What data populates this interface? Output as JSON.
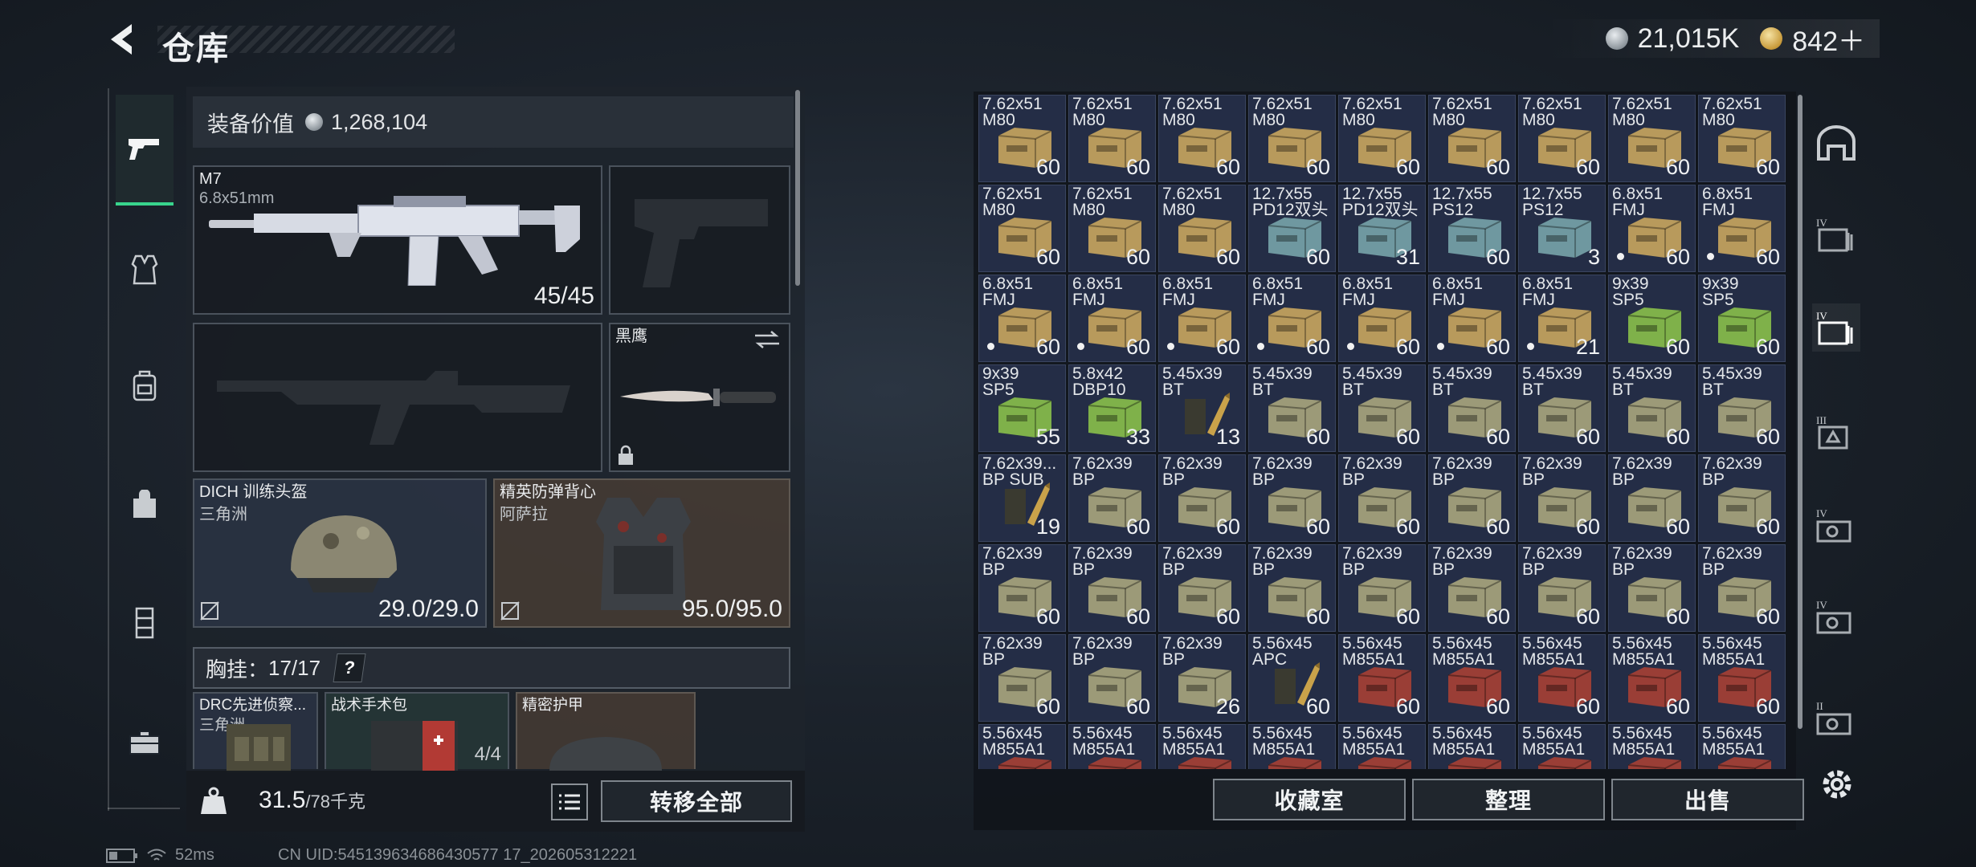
{
  "header": {
    "title": "仓库",
    "currencies": [
      {
        "icon": "silver-coin-icon",
        "value": "21,015K"
      },
      {
        "icon": "gold-coin-icon",
        "value": "842＋"
      }
    ]
  },
  "side_tabs": [
    {
      "name": "weapons-tab",
      "icon": "pistol-icon",
      "active": true
    },
    {
      "name": "armor-vest-tab",
      "icon": "vest-icon"
    },
    {
      "name": "backpack-tab",
      "icon": "backpack-icon"
    },
    {
      "name": "bag-tab",
      "icon": "bag-icon"
    },
    {
      "name": "rig-tab",
      "icon": "rig-icon"
    },
    {
      "name": "case-tab",
      "icon": "toolbox-icon"
    }
  ],
  "loadout": {
    "value_label": "装备价值",
    "value": "1,268,104",
    "primary": {
      "name": "M7",
      "caliber": "6.8x51mm",
      "ammo": "45/45"
    },
    "melee": {
      "name": "黑鹰"
    },
    "helmet": {
      "name": "DICH 训练头盔",
      "faction": "三角洲",
      "durability": "29.0/29.0"
    },
    "armor": {
      "name": "精英防弹背心",
      "faction": "阿萨拉",
      "durability": "95.0/95.0"
    },
    "chest_rig": {
      "label": "胸挂：",
      "value": "17/17",
      "help": "?"
    },
    "sub_slots": [
      {
        "name": "DRC先进侦察...",
        "faction": "三角洲"
      },
      {
        "name": "战术手术包",
        "count": "4/4"
      },
      {
        "name": "精密护甲"
      }
    ],
    "weight": {
      "value": "31.5",
      "max": "/78千克"
    },
    "transfer_all": "转移全部"
  },
  "inventory": {
    "colors": {
      "tan": "#b89a5c",
      "teal": "#6f98a0",
      "green": "#7fb14a",
      "olive": "#9c9a78",
      "red": "#9a3e36",
      "brass": "#c9a24a"
    },
    "items": [
      {
        "cal": "7.62x51\nM80",
        "qty": "60",
        "color": "tan"
      },
      {
        "cal": "7.62x51\nM80",
        "qty": "60",
        "color": "tan"
      },
      {
        "cal": "7.62x51\nM80",
        "qty": "60",
        "color": "tan"
      },
      {
        "cal": "7.62x51\nM80",
        "qty": "60",
        "color": "tan"
      },
      {
        "cal": "7.62x51\nM80",
        "qty": "60",
        "color": "tan"
      },
      {
        "cal": "7.62x51\nM80",
        "qty": "60",
        "color": "tan"
      },
      {
        "cal": "7.62x51\nM80",
        "qty": "60",
        "color": "tan"
      },
      {
        "cal": "7.62x51\nM80",
        "qty": "60",
        "color": "tan"
      },
      {
        "cal": "7.62x51\nM80",
        "qty": "60",
        "color": "tan"
      },
      {
        "cal": "7.62x51\nM80",
        "qty": "60",
        "color": "tan"
      },
      {
        "cal": "7.62x51\nM80",
        "qty": "60",
        "color": "tan"
      },
      {
        "cal": "7.62x51\nM80",
        "qty": "60",
        "color": "tan"
      },
      {
        "cal": "12.7x55\nPD12双头",
        "qty": "60",
        "color": "teal"
      },
      {
        "cal": "12.7x55\nPD12双头",
        "qty": "31",
        "color": "teal"
      },
      {
        "cal": "12.7x55\nPS12",
        "qty": "60",
        "color": "teal"
      },
      {
        "cal": "12.7x55\nPS12",
        "qty": "3",
        "color": "teal"
      },
      {
        "cal": "6.8x51\nFMJ",
        "qty": "60",
        "color": "tan",
        "dot": true
      },
      {
        "cal": "6.8x51\nFMJ",
        "qty": "60",
        "color": "tan",
        "dot": true
      },
      {
        "cal": "6.8x51\nFMJ",
        "qty": "60",
        "color": "tan",
        "dot": true
      },
      {
        "cal": "6.8x51\nFMJ",
        "qty": "60",
        "color": "tan",
        "dot": true
      },
      {
        "cal": "6.8x51\nFMJ",
        "qty": "60",
        "color": "tan",
        "dot": true
      },
      {
        "cal": "6.8x51\nFMJ",
        "qty": "60",
        "color": "tan",
        "dot": true
      },
      {
        "cal": "6.8x51\nFMJ",
        "qty": "60",
        "color": "tan",
        "dot": true
      },
      {
        "cal": "6.8x51\nFMJ",
        "qty": "60",
        "color": "tan",
        "dot": true
      },
      {
        "cal": "6.8x51\nFMJ",
        "qty": "21",
        "color": "tan",
        "dot": true
      },
      {
        "cal": "9x39\nSP5",
        "qty": "60",
        "color": "green"
      },
      {
        "cal": "9x39\nSP5",
        "qty": "60",
        "color": "green"
      },
      {
        "cal": "9x39\nSP5",
        "qty": "55",
        "color": "green"
      },
      {
        "cal": "5.8x42\nDBP10",
        "qty": "33",
        "color": "green"
      },
      {
        "cal": "5.45x39\nBT",
        "qty": "13",
        "color": "brass"
      },
      {
        "cal": "5.45x39\nBT",
        "qty": "60",
        "color": "olive"
      },
      {
        "cal": "5.45x39\nBT",
        "qty": "60",
        "color": "olive"
      },
      {
        "cal": "5.45x39\nBT",
        "qty": "60",
        "color": "olive"
      },
      {
        "cal": "5.45x39\nBT",
        "qty": "60",
        "color": "olive"
      },
      {
        "cal": "5.45x39\nBT",
        "qty": "60",
        "color": "olive"
      },
      {
        "cal": "5.45x39\nBT",
        "qty": "60",
        "color": "olive"
      },
      {
        "cal": "7.62x39...\nBP SUB",
        "qty": "19",
        "color": "brass"
      },
      {
        "cal": "7.62x39\nBP",
        "qty": "60",
        "color": "olive"
      },
      {
        "cal": "7.62x39\nBP",
        "qty": "60",
        "color": "olive"
      },
      {
        "cal": "7.62x39\nBP",
        "qty": "60",
        "color": "olive"
      },
      {
        "cal": "7.62x39\nBP",
        "qty": "60",
        "color": "olive"
      },
      {
        "cal": "7.62x39\nBP",
        "qty": "60",
        "color": "olive"
      },
      {
        "cal": "7.62x39\nBP",
        "qty": "60",
        "color": "olive"
      },
      {
        "cal": "7.62x39\nBP",
        "qty": "60",
        "color": "olive"
      },
      {
        "cal": "7.62x39\nBP",
        "qty": "60",
        "color": "olive"
      },
      {
        "cal": "7.62x39\nBP",
        "qty": "60",
        "color": "olive"
      },
      {
        "cal": "7.62x39\nBP",
        "qty": "60",
        "color": "olive"
      },
      {
        "cal": "7.62x39\nBP",
        "qty": "60",
        "color": "olive"
      },
      {
        "cal": "7.62x39\nBP",
        "qty": "60",
        "color": "olive"
      },
      {
        "cal": "7.62x39\nBP",
        "qty": "60",
        "color": "olive"
      },
      {
        "cal": "7.62x39\nBP",
        "qty": "60",
        "color": "olive"
      },
      {
        "cal": "7.62x39\nBP",
        "qty": "60",
        "color": "olive"
      },
      {
        "cal": "7.62x39\nBP",
        "qty": "60",
        "color": "olive"
      },
      {
        "cal": "7.62x39\nBP",
        "qty": "60",
        "color": "olive"
      },
      {
        "cal": "7.62x39\nBP",
        "qty": "60",
        "color": "olive"
      },
      {
        "cal": "7.62x39\nBP",
        "qty": "60",
        "color": "olive"
      },
      {
        "cal": "7.62x39\nBP",
        "qty": "26",
        "color": "olive"
      },
      {
        "cal": "5.56x45\nAPC",
        "qty": "60",
        "color": "brass"
      },
      {
        "cal": "5.56x45\nM855A1",
        "qty": "60",
        "color": "red"
      },
      {
        "cal": "5.56x45\nM855A1",
        "qty": "60",
        "color": "red"
      },
      {
        "cal": "5.56x45\nM855A1",
        "qty": "60",
        "color": "red"
      },
      {
        "cal": "5.56x45\nM855A1",
        "qty": "60",
        "color": "red"
      },
      {
        "cal": "5.56x45\nM855A1",
        "qty": "60",
        "color": "red"
      },
      {
        "cal": "5.56x45\nM855A1",
        "qty": "",
        "color": "red"
      },
      {
        "cal": "5.56x45\nM855A1",
        "qty": "",
        "color": "red"
      },
      {
        "cal": "5.56x45\nM855A1",
        "qty": "",
        "color": "red"
      },
      {
        "cal": "5.56x45\nM855A1",
        "qty": "",
        "color": "red"
      },
      {
        "cal": "5.56x45\nM855A1",
        "qty": "",
        "color": "red"
      },
      {
        "cal": "5.56x45\nM855A1",
        "qty": "",
        "color": "red"
      },
      {
        "cal": "5.56x45\nM855A1",
        "qty": "",
        "color": "red"
      },
      {
        "cal": "5.56x45\nM855A1",
        "qty": "",
        "color": "red"
      },
      {
        "cal": "5.56x45\nM855A1",
        "qty": "",
        "color": "red"
      }
    ]
  },
  "right_tabs": [
    {
      "name": "stash-tab",
      "icon": "bunker-icon",
      "level": ""
    },
    {
      "name": "container-tab-4a",
      "icon": "container-icon",
      "level": "IV"
    },
    {
      "name": "container-tab-4b",
      "icon": "container-icon",
      "level": "IV",
      "active": true
    },
    {
      "name": "container-tab-3",
      "icon": "container-icon",
      "level": "III"
    },
    {
      "name": "case-tab-4a",
      "icon": "case-icon",
      "level": "IV"
    },
    {
      "name": "case-tab-4b",
      "icon": "case-icon",
      "level": "IV"
    },
    {
      "name": "case-tab-2",
      "icon": "case-icon",
      "level": "II"
    }
  ],
  "actions": {
    "collection": "收藏室",
    "sort": "整理",
    "sell": "出售"
  },
  "status_bar": {
    "ping": "52ms",
    "uid": "CN UID:545139634686430577 17_202605312221"
  }
}
